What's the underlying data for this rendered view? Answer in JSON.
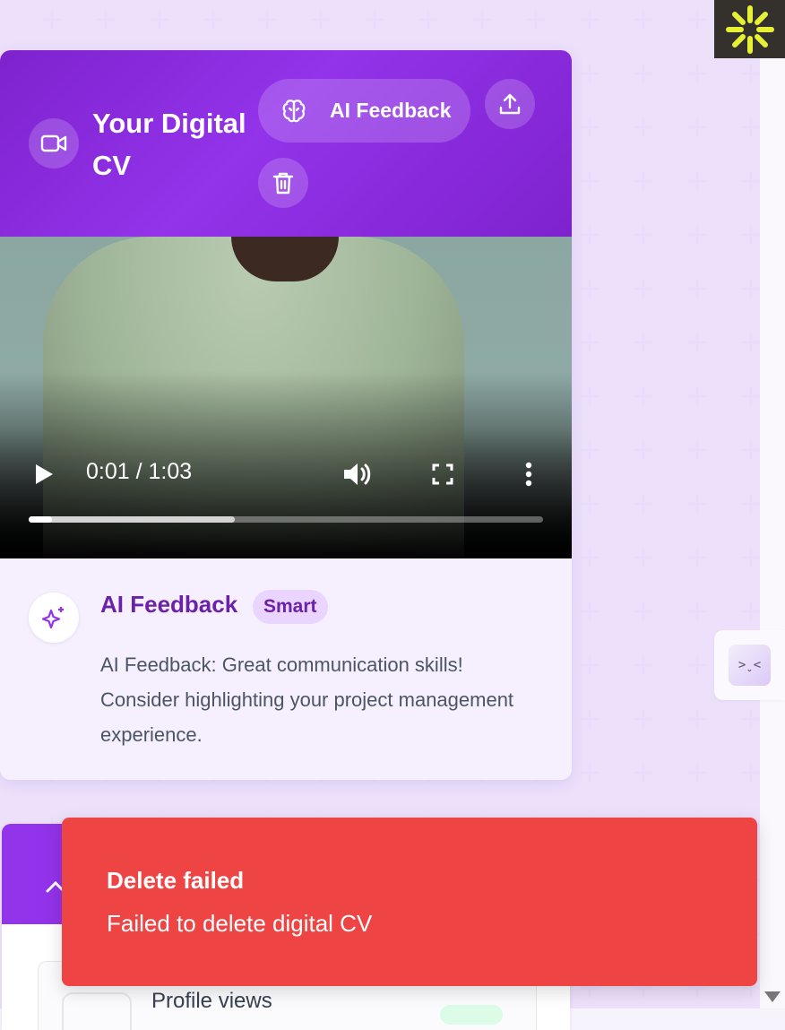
{
  "digital_cv": {
    "title": "Your Digital CV",
    "ai_feedback_button": "AI Feedback"
  },
  "video": {
    "time": "0:01 / 1:03",
    "progress": 0.045,
    "buffered": 0.4
  },
  "feedback": {
    "title": "AI Feedback",
    "badge": "Smart",
    "text": "AI Feedback: Great communication skills! Consider highlighting your project management experience."
  },
  "stats": {
    "profile_views_label": "Profile views"
  },
  "toast": {
    "title": "Delete failed",
    "message": "Failed to delete digital CV"
  },
  "side_tab": {
    "glyph": ">ˬ<"
  },
  "colors": {
    "header_purple": "#9333ea",
    "toast_red": "#ef4444",
    "badge_bg": "#e9d5ff",
    "logo_yellow": "#e6f034"
  }
}
